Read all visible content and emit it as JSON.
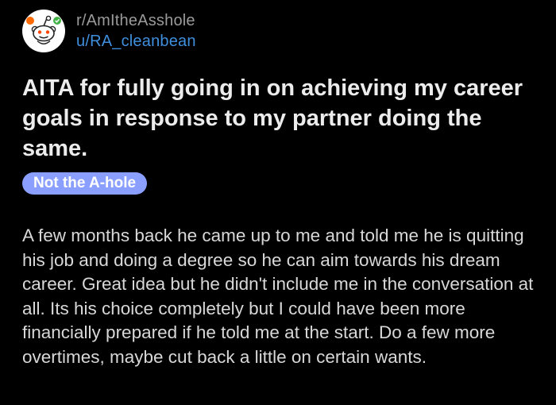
{
  "post": {
    "subreddit": "r/AmItheAsshole",
    "author": "u/RA_cleanbean",
    "title": "AITA for fully going in on achieving my career goals in response to my partner doing the same.",
    "flair": "Not the A-hole",
    "body": "A few months back he came up to me and told me he is quitting his job and doing a degree so he can aim towards his dream career. Great idea but he didn't include me in the conversation at all. Its his choice completely but I could have been more financially prepared if he told me at the start. Do a few more overtimes, maybe cut back a little on certain wants."
  },
  "icons": {
    "avatar": "reddit-snoo-icon"
  },
  "colors": {
    "background": "#000000",
    "username": "#3f8fde",
    "subreddit": "#9a9a9a",
    "flair_bg": "#8a9fff"
  }
}
